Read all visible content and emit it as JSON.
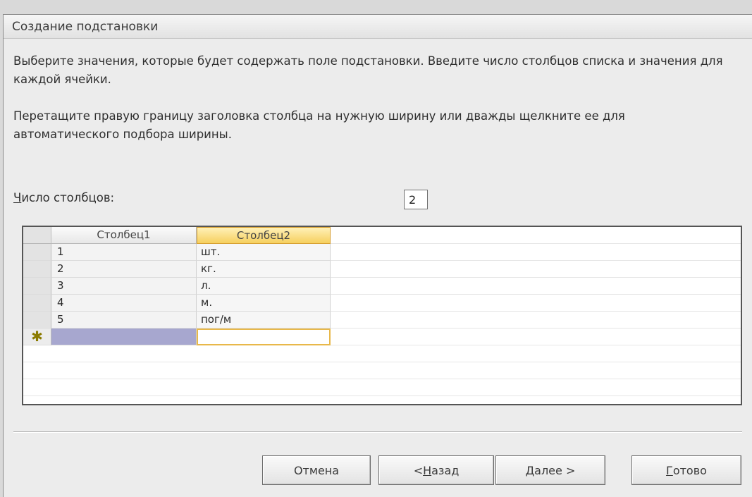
{
  "window": {
    "title": "Создание подстановки"
  },
  "instructions": {
    "p1": "Выберите значения, которые будет содержать поле подстановки. Введите число столбцов списка и значения для каждой ячейки.",
    "p2": "Перетащите правую границу заголовка столбца на нужную ширину или дважды щелкните ее для автоматического подбора ширины."
  },
  "columns_count": {
    "label_first": "Ч",
    "label_rest": "исло столбцов:",
    "value": "2"
  },
  "grid": {
    "headers": [
      "Столбец1",
      "Столбец2"
    ],
    "rows": [
      [
        "1",
        "шт."
      ],
      [
        "2",
        "кг."
      ],
      [
        "3",
        "л."
      ],
      [
        "4",
        "м."
      ],
      [
        "5",
        "пог/м"
      ]
    ],
    "new_row_marker": "✱"
  },
  "buttons": {
    "cancel": "Отмена",
    "back_arrow": "< ",
    "back_first": "Н",
    "back_rest": "азад",
    "next_first": "Д",
    "next_rest": "алее >",
    "finish_first": "Г",
    "finish_rest": "отово"
  }
}
